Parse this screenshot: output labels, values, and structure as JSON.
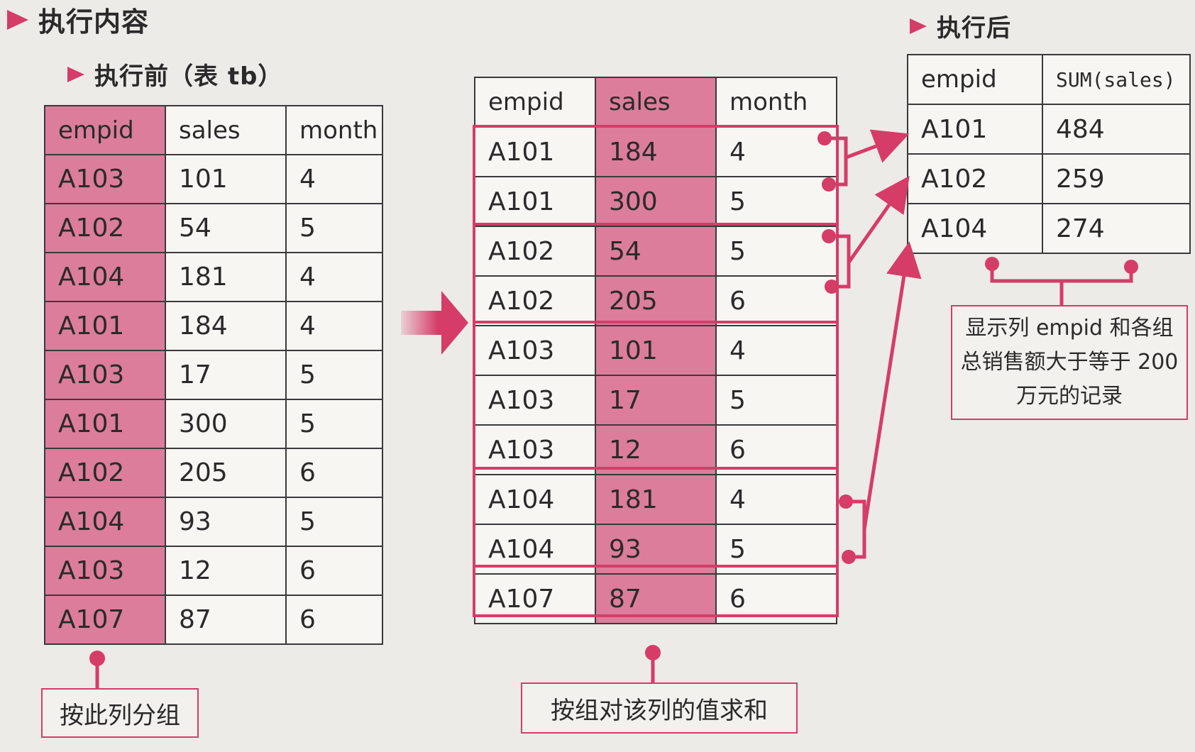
{
  "titles": {
    "main": "执行内容",
    "before": "执行前（表 tb）",
    "after": "执行后"
  },
  "before_table": {
    "headers": [
      "empid",
      "sales",
      "month"
    ],
    "rows": [
      [
        "A103",
        "101",
        "4"
      ],
      [
        "A102",
        "54",
        "5"
      ],
      [
        "A104",
        "181",
        "4"
      ],
      [
        "A101",
        "184",
        "4"
      ],
      [
        "A103",
        "17",
        "5"
      ],
      [
        "A101",
        "300",
        "5"
      ],
      [
        "A102",
        "205",
        "6"
      ],
      [
        "A104",
        "93",
        "5"
      ],
      [
        "A103",
        "12",
        "6"
      ],
      [
        "A107",
        "87",
        "6"
      ]
    ]
  },
  "grouped_table": {
    "headers": [
      "empid",
      "sales",
      "month"
    ],
    "rows": [
      [
        "A101",
        "184",
        "4"
      ],
      [
        "A101",
        "300",
        "5"
      ],
      [
        "A102",
        "54",
        "5"
      ],
      [
        "A102",
        "205",
        "6"
      ],
      [
        "A103",
        "101",
        "4"
      ],
      [
        "A103",
        "17",
        "5"
      ],
      [
        "A103",
        "12",
        "6"
      ],
      [
        "A104",
        "181",
        "4"
      ],
      [
        "A104",
        "93",
        "5"
      ],
      [
        "A107",
        "87",
        "6"
      ]
    ],
    "groups": [
      2,
      2,
      3,
      2,
      1
    ]
  },
  "after_table": {
    "headers": [
      "empid",
      "SUM(sales)"
    ],
    "rows": [
      [
        "A101",
        "484"
      ],
      [
        "A102",
        "259"
      ],
      [
        "A104",
        "274"
      ]
    ]
  },
  "notes": {
    "group_by": "按此列分组",
    "sum": "按组对该列的值求和",
    "result": "显示列 empid 和各组总销售额大于等于 200 万元的记录"
  },
  "colors": {
    "accent": "#d63c68",
    "highlight": "#dc7d9c",
    "background": "#ecebe8"
  }
}
